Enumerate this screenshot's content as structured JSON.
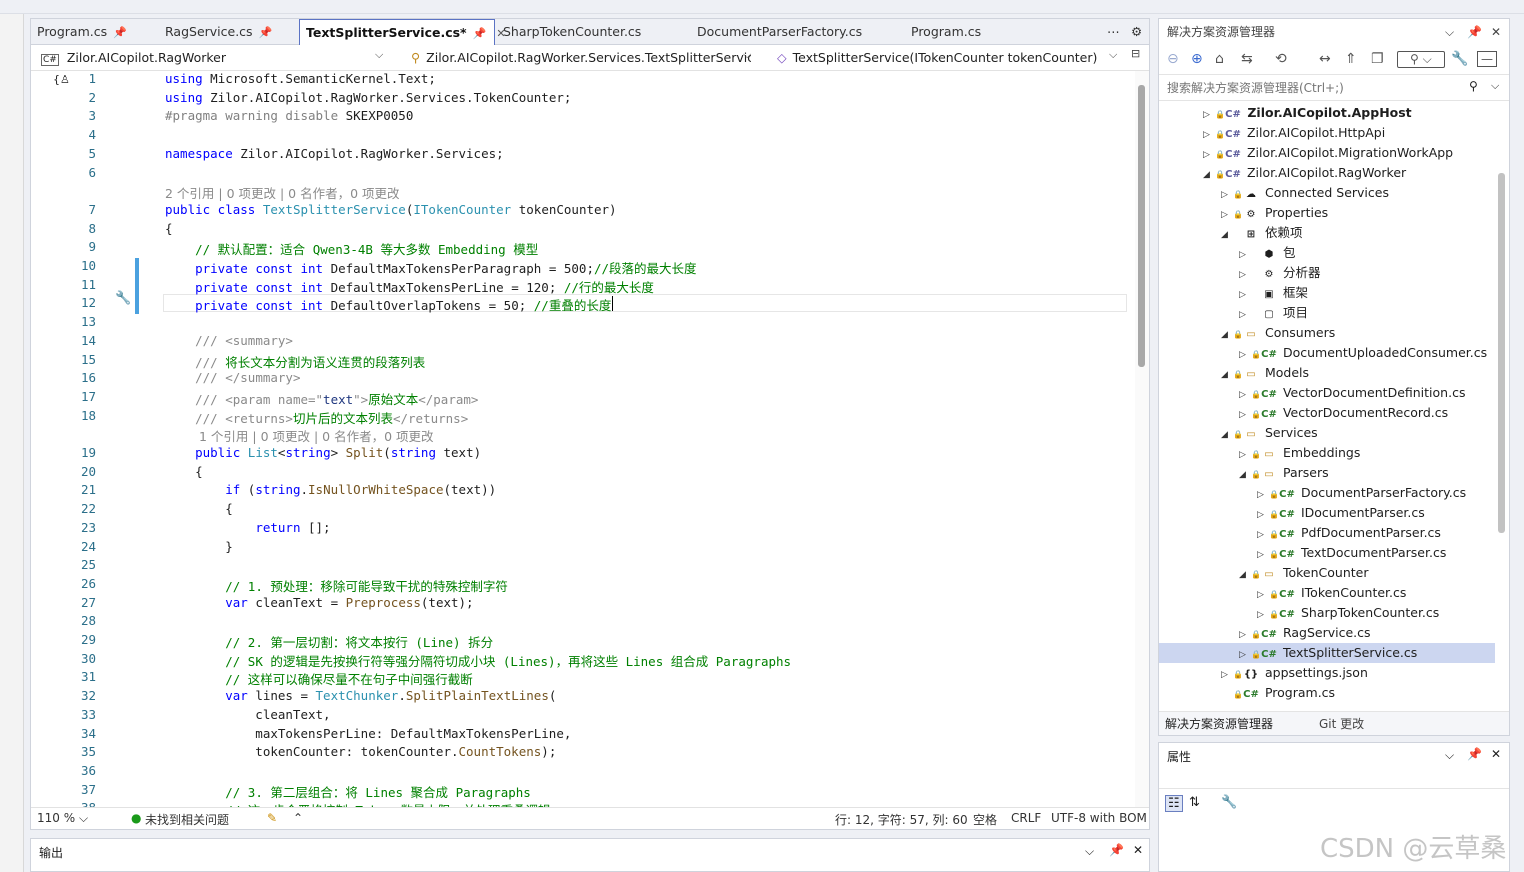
{
  "tabs": [
    {
      "label": "Program.cs",
      "pinned": true
    },
    {
      "label": "RagService.cs",
      "pinned": true
    },
    {
      "label": "TextSplitterService.cs*",
      "pinned": true,
      "active": true
    },
    {
      "label": "SharpTokenCounter.cs"
    },
    {
      "label": "DocumentParserFactory.cs"
    },
    {
      "label": "Program.cs"
    }
  ],
  "navbar": {
    "project": "Zilor.AICopilot.RagWorker",
    "type": "Zilor.AICopilot.RagWorker.Services.TextSplitterServic",
    "member": "TextSplitterService(ITokenCounter tokenCounter)"
  },
  "code_lines": [
    {
      "n": "1",
      "segs": [
        [
          "kw",
          "using"
        ],
        [
          "ns",
          " Microsoft.SemanticKernel.Text;"
        ]
      ]
    },
    {
      "n": "2",
      "segs": [
        [
          "kw",
          "using"
        ],
        [
          "ns",
          " Zilor.AICopilot.RagWorker.Services.TokenCounter;"
        ]
      ]
    },
    {
      "n": "3",
      "segs": [
        [
          "pp",
          "#pragma warning disable"
        ],
        [
          "ns",
          " SKEXP0050"
        ]
      ]
    },
    {
      "n": "4",
      "segs": []
    },
    {
      "n": "5",
      "segs": [
        [
          "kw",
          "namespace"
        ],
        [
          "ns",
          " Zilor.AICopilot.RagWorker.Services;"
        ]
      ]
    },
    {
      "n": "6",
      "segs": []
    },
    {
      "n": "",
      "lens": "2 个引用 | 0 项更改 | 0 名作者，0 项更改",
      "indent": 0
    },
    {
      "n": "7",
      "segs": [
        [
          "kw",
          "public class "
        ],
        [
          "ty",
          "TextSplitterService"
        ],
        [
          "ns",
          "("
        ],
        [
          "ty",
          "ITokenCounter"
        ],
        [
          "ns",
          " tokenCounter)"
        ]
      ]
    },
    {
      "n": "8",
      "segs": [
        [
          "ns",
          "{"
        ]
      ]
    },
    {
      "n": "9",
      "segs": [
        [
          "ns",
          "    "
        ],
        [
          "cm",
          "// 默认配置：适合 Qwen3-4B 等大多数 Embedding 模型"
        ]
      ]
    },
    {
      "n": "10",
      "segs": [
        [
          "ns",
          "    "
        ],
        [
          "kw",
          "private const int"
        ],
        [
          "ns",
          " DefaultMaxTokensPerParagraph = 500;"
        ],
        [
          "cm",
          "//段落的最大长度"
        ]
      ]
    },
    {
      "n": "11",
      "segs": [
        [
          "ns",
          "    "
        ],
        [
          "kw",
          "private const int"
        ],
        [
          "ns",
          " DefaultMaxTokensPerLine = 120; "
        ],
        [
          "cm",
          "//行的最大长度"
        ]
      ]
    },
    {
      "n": "12",
      "segs": [
        [
          "ns",
          "    "
        ],
        [
          "kw",
          "private const int"
        ],
        [
          "ns",
          " DefaultOverlapTokens = 50; "
        ],
        [
          "cm",
          "//重叠的长度"
        ]
      ]
    },
    {
      "n": "13",
      "segs": []
    },
    {
      "n": "14",
      "segs": [
        [
          "ns",
          "    "
        ],
        [
          "dc",
          "/// <summary>"
        ]
      ]
    },
    {
      "n": "15",
      "segs": [
        [
          "ns",
          "    "
        ],
        [
          "dc",
          "/// "
        ],
        [
          "cm",
          "将长文本分割为语义连贯的段落列表"
        ]
      ]
    },
    {
      "n": "16",
      "segs": [
        [
          "ns",
          "    "
        ],
        [
          "dc",
          "/// </summary>"
        ]
      ]
    },
    {
      "n": "17",
      "segs": [
        [
          "ns",
          "    "
        ],
        [
          "dc",
          "/// <param name=\""
        ],
        [
          "pm",
          "text"
        ],
        [
          "dc",
          "\">"
        ],
        [
          "cm",
          "原始文本"
        ],
        [
          "dc",
          "</param>"
        ]
      ]
    },
    {
      "n": "18",
      "segs": [
        [
          "ns",
          "    "
        ],
        [
          "dc",
          "/// <returns>"
        ],
        [
          "cm",
          "切片后的文本列表"
        ],
        [
          "dc",
          "</returns>"
        ]
      ]
    },
    {
      "n": "",
      "lens": "1 个引用 | 0 项更改 | 0 名作者，0 项更改",
      "indent": 1
    },
    {
      "n": "19",
      "segs": [
        [
          "ns",
          "    "
        ],
        [
          "kw",
          "public "
        ],
        [
          "ty",
          "List"
        ],
        [
          "ns",
          "<"
        ],
        [
          "kw",
          "string"
        ],
        [
          "ns",
          "> "
        ],
        [
          "mt",
          "Split"
        ],
        [
          "ns",
          "("
        ],
        [
          "kw",
          "string"
        ],
        [
          "ns",
          " text)"
        ]
      ]
    },
    {
      "n": "20",
      "segs": [
        [
          "ns",
          "    {"
        ]
      ]
    },
    {
      "n": "21",
      "segs": [
        [
          "ns",
          "        "
        ],
        [
          "kw",
          "if"
        ],
        [
          "ns",
          " ("
        ],
        [
          "kw",
          "string"
        ],
        [
          "ns",
          "."
        ],
        [
          "mt",
          "IsNullOrWhiteSpace"
        ],
        [
          "ns",
          "(text))"
        ]
      ]
    },
    {
      "n": "22",
      "segs": [
        [
          "ns",
          "        {"
        ]
      ]
    },
    {
      "n": "23",
      "segs": [
        [
          "ns",
          "            "
        ],
        [
          "kw",
          "return"
        ],
        [
          "ns",
          " [];"
        ]
      ]
    },
    {
      "n": "24",
      "segs": [
        [
          "ns",
          "        }"
        ]
      ]
    },
    {
      "n": "25",
      "segs": []
    },
    {
      "n": "26",
      "segs": [
        [
          "ns",
          "        "
        ],
        [
          "cm",
          "// 1. 预处理：移除可能导致干扰的特殊控制字符"
        ]
      ]
    },
    {
      "n": "27",
      "segs": [
        [
          "ns",
          "        "
        ],
        [
          "kw",
          "var"
        ],
        [
          "ns",
          " cleanText = "
        ],
        [
          "mt",
          "Preprocess"
        ],
        [
          "ns",
          "(text);"
        ]
      ]
    },
    {
      "n": "28",
      "segs": []
    },
    {
      "n": "29",
      "segs": [
        [
          "ns",
          "        "
        ],
        [
          "cm",
          "// 2. 第一层切割：将文本按行 (Line) 拆分"
        ]
      ]
    },
    {
      "n": "30",
      "segs": [
        [
          "ns",
          "        "
        ],
        [
          "cm",
          "// SK 的逻辑是先按换行符等强分隔符切成小块 (Lines)，再将这些 Lines 组合成 Paragraphs"
        ]
      ]
    },
    {
      "n": "31",
      "segs": [
        [
          "ns",
          "        "
        ],
        [
          "cm",
          "// 这样可以确保尽量不在句子中间强行截断"
        ]
      ]
    },
    {
      "n": "32",
      "segs": [
        [
          "ns",
          "        "
        ],
        [
          "kw",
          "var"
        ],
        [
          "ns",
          " lines = "
        ],
        [
          "ty",
          "TextChunker"
        ],
        [
          "ns",
          "."
        ],
        [
          "mt",
          "SplitPlainTextLines"
        ],
        [
          "ns",
          "("
        ]
      ]
    },
    {
      "n": "33",
      "segs": [
        [
          "ns",
          "            cleanText,"
        ]
      ]
    },
    {
      "n": "34",
      "segs": [
        [
          "ns",
          "            maxTokensPerLine: DefaultMaxTokensPerLine,"
        ]
      ]
    },
    {
      "n": "35",
      "segs": [
        [
          "ns",
          "            tokenCounter: tokenCounter."
        ],
        [
          "mt",
          "CountTokens"
        ],
        [
          "ns",
          ");"
        ]
      ]
    },
    {
      "n": "36",
      "segs": []
    },
    {
      "n": "37",
      "segs": [
        [
          "ns",
          "        "
        ],
        [
          "cm",
          "// 3. 第二层组合：将 Lines 聚合成 Paragraphs"
        ]
      ]
    },
    {
      "n": "38",
      "segs": [
        [
          "ns",
          "        "
        ],
        [
          "cm",
          "// 这一步会严格控制 Token 数量上限，并处理重叠逻辑"
        ]
      ]
    }
  ],
  "status": {
    "zoom": "110 %",
    "issues": "未找到相关问题",
    "position": "行: 12, 字符: 57, 列: 60",
    "whitespace": "空格",
    "line_ending": "CRLF",
    "encoding": "UTF-8 with BOM"
  },
  "output": {
    "title": "输出"
  },
  "solution_explorer": {
    "title": "解决方案资源管理器",
    "search_placeholder": "搜索解决方案资源管理器(Ctrl+;)",
    "items": [
      {
        "label": "Zilor.AICopilot.AppHost",
        "depth": 1,
        "arrow": "▷",
        "icon": "proj",
        "bold": true
      },
      {
        "label": "Zilor.AICopilot.HttpApi",
        "depth": 1,
        "arrow": "▷",
        "icon": "proj"
      },
      {
        "label": "Zilor.AICopilot.MigrationWorkApp",
        "depth": 1,
        "arrow": "▷",
        "icon": "proj"
      },
      {
        "label": "Zilor.AICopilot.RagWorker",
        "depth": 1,
        "arrow": "◢",
        "icon": "proj"
      },
      {
        "label": "Connected Services",
        "depth": 2,
        "arrow": "▷",
        "icon": "conn"
      },
      {
        "label": "Properties",
        "depth": 2,
        "arrow": "▷",
        "icon": "prop"
      },
      {
        "label": "依赖项",
        "depth": 2,
        "arrow": "◢",
        "icon": "dep"
      },
      {
        "label": "包",
        "depth": 3,
        "arrow": "▷",
        "icon": "pkg"
      },
      {
        "label": "分析器",
        "depth": 3,
        "arrow": "▷",
        "icon": "ana"
      },
      {
        "label": "框架",
        "depth": 3,
        "arrow": "▷",
        "icon": "fw"
      },
      {
        "label": "项目",
        "depth": 3,
        "arrow": "▷",
        "icon": "prj"
      },
      {
        "label": "Consumers",
        "depth": 2,
        "arrow": "◢",
        "icon": "fold"
      },
      {
        "label": "DocumentUploadedConsumer.cs",
        "depth": 3,
        "arrow": "▷",
        "icon": "cs"
      },
      {
        "label": "Models",
        "depth": 2,
        "arrow": "◢",
        "icon": "fold"
      },
      {
        "label": "VectorDocumentDefinition.cs",
        "depth": 3,
        "arrow": "▷",
        "icon": "cs"
      },
      {
        "label": "VectorDocumentRecord.cs",
        "depth": 3,
        "arrow": "▷",
        "icon": "cs"
      },
      {
        "label": "Services",
        "depth": 2,
        "arrow": "◢",
        "icon": "fold"
      },
      {
        "label": "Embeddings",
        "depth": 3,
        "arrow": "▷",
        "icon": "fold"
      },
      {
        "label": "Parsers",
        "depth": 3,
        "arrow": "◢",
        "icon": "fold"
      },
      {
        "label": "DocumentParserFactory.cs",
        "depth": 4,
        "arrow": "▷",
        "icon": "cs"
      },
      {
        "label": "IDocumentParser.cs",
        "depth": 4,
        "arrow": "▷",
        "icon": "cs"
      },
      {
        "label": "PdfDocumentParser.cs",
        "depth": 4,
        "arrow": "▷",
        "icon": "cs"
      },
      {
        "label": "TextDocumentParser.cs",
        "depth": 4,
        "arrow": "▷",
        "icon": "cs"
      },
      {
        "label": "TokenCounter",
        "depth": 3,
        "arrow": "◢",
        "icon": "fold"
      },
      {
        "label": "ITokenCounter.cs",
        "depth": 4,
        "arrow": "▷",
        "icon": "cs"
      },
      {
        "label": "SharpTokenCounter.cs",
        "depth": 4,
        "arrow": "▷",
        "icon": "cs"
      },
      {
        "label": "RagService.cs",
        "depth": 3,
        "arrow": "▷",
        "icon": "cs"
      },
      {
        "label": "TextSplitterService.cs",
        "depth": 3,
        "arrow": "▷",
        "icon": "cs",
        "selected": true
      },
      {
        "label": "appsettings.json",
        "depth": 2,
        "arrow": "▷",
        "icon": "json"
      },
      {
        "label": "Program.cs",
        "depth": 2,
        "arrow": "",
        "icon": "cs"
      }
    ],
    "bottom_tabs": [
      "解决方案资源管理器",
      "Git 更改"
    ]
  },
  "properties": {
    "title": "属性"
  },
  "watermark": "CSDN @云草桑",
  "icons": {
    "cs": "C#",
    "fold": "▭",
    "proj": "C#",
    "conn": "☁",
    "prop": "⚙",
    "dep": "⊞",
    "pkg": "⬢",
    "ana": "⚙",
    "fw": "▣",
    "prj": "▢",
    "json": "{}"
  }
}
